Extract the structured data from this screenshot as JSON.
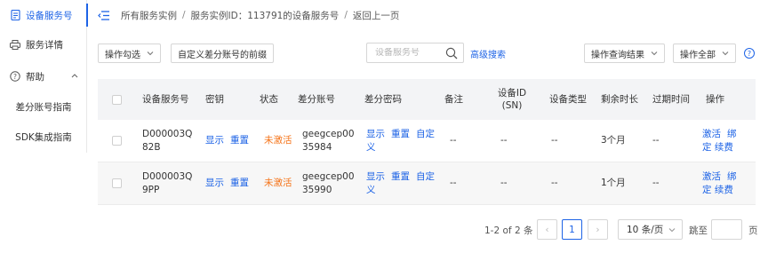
{
  "sidebar": {
    "items": [
      {
        "label": "设备服务号",
        "icon": "document-icon"
      },
      {
        "label": "服务详情",
        "icon": "printer-icon"
      },
      {
        "label": "帮助",
        "icon": "question-circle-icon"
      }
    ],
    "help_children": [
      "差分账号指南",
      "SDK集成指南"
    ]
  },
  "breadcrumb": {
    "items": [
      "所有服务实例",
      "服务实例ID：113791的设备服务号",
      "返回上一页"
    ],
    "separator": "/"
  },
  "toolbar": {
    "operate_selected": "操作勾选",
    "custom_prefix": "自定义差分账号的前缀",
    "search_placeholder": "设备服务号",
    "advanced_search": "高级搜索",
    "operate_results": "操作查询结果",
    "operate_all": "操作全部"
  },
  "table": {
    "headers": [
      "设备服务号",
      "密钥",
      "状态",
      "差分账号",
      "差分密码",
      "备注",
      "设备ID(SN)",
      "设备类型",
      "剩余时长",
      "过期时间",
      "操作"
    ],
    "rows": [
      {
        "device_no": "D000003Q82B",
        "key_show": "显示",
        "key_reset": "重置",
        "status": "未激活",
        "diff_account": "geegcep0035984",
        "pwd_show": "显示",
        "pwd_reset": "重置",
        "pwd_custom": "自定义",
        "remark": "--",
        "device_sn": "--",
        "device_type": "--",
        "remaining": "3个月",
        "expire": "--",
        "act_activate": "激活",
        "act_bind": "绑定",
        "act_renew": "续费"
      },
      {
        "device_no": "D000003Q9PP",
        "key_show": "显示",
        "key_reset": "重置",
        "status": "未激活",
        "diff_account": "geegcep0035990",
        "pwd_show": "显示",
        "pwd_reset": "重置",
        "pwd_custom": "自定义",
        "remark": "--",
        "device_sn": "--",
        "device_type": "--",
        "remaining": "1个月",
        "expire": "--",
        "act_activate": "激活",
        "act_bind": "绑定",
        "act_renew": "续费"
      }
    ]
  },
  "pagination": {
    "total": "1-2 of 2 条",
    "prev": "‹",
    "current": "1",
    "next": "›",
    "page_size": "10 条/页",
    "goto_label": "跳至",
    "goto_value": "",
    "page_suffix": "页"
  },
  "colors": {
    "accent": "#1d63e6",
    "warning": "#f5741a"
  }
}
